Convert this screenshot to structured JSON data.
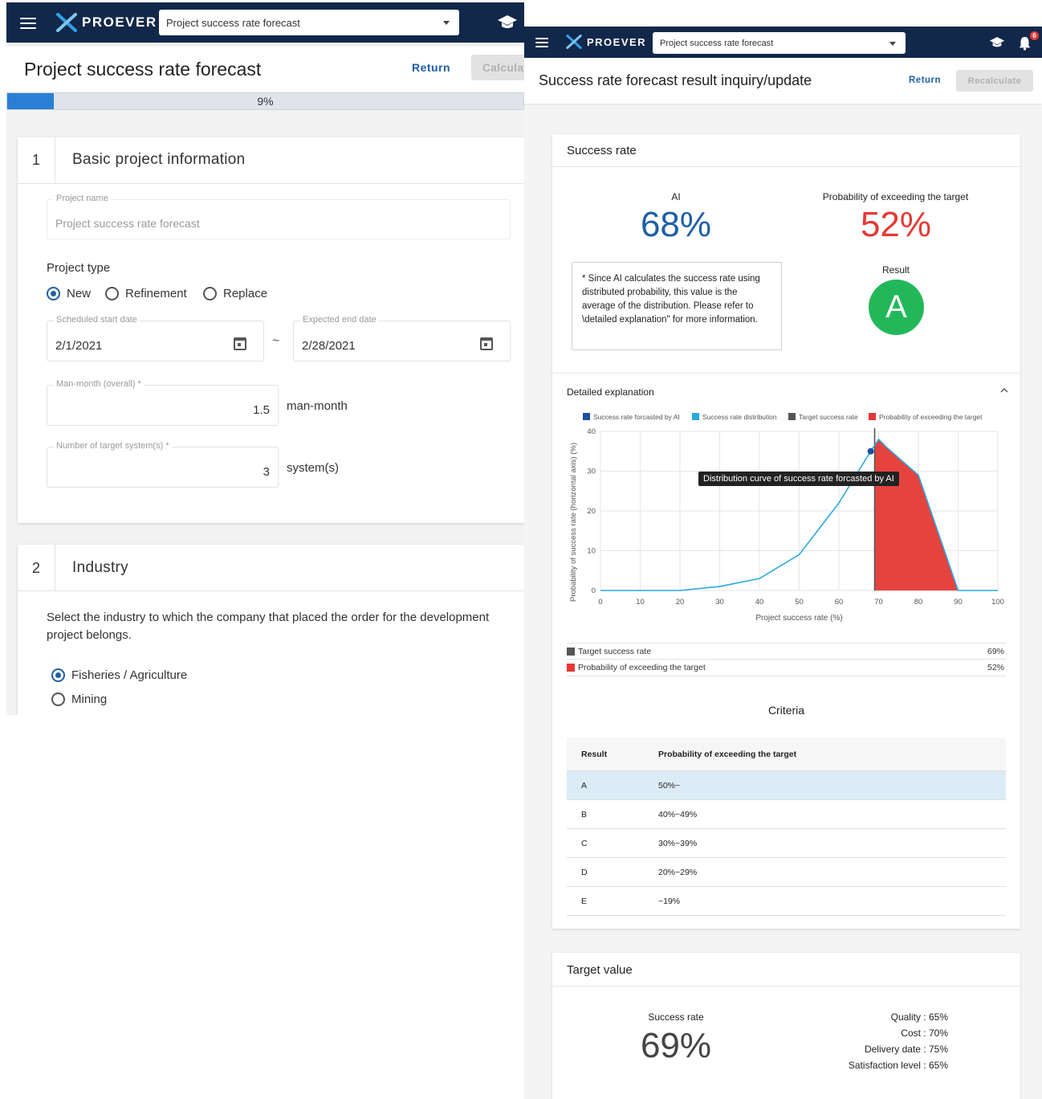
{
  "left": {
    "brand": "PROEVER",
    "project_select": "Project success rate forecast",
    "notification_count": "6",
    "page_title": "Project success rate forecast",
    "return_label": "Return",
    "calc_label": "Calculate",
    "progress": {
      "percent_label": "9%",
      "fraction": 0.09
    },
    "section1": {
      "number": "1",
      "title": "Basic project information",
      "project_name_label": "Project name",
      "project_name_value": "Project success rate forecast",
      "project_type_label": "Project type",
      "project_type_options": [
        "New",
        "Refinement",
        "Replace"
      ],
      "project_type_selected": "New",
      "start_label": "Scheduled start date",
      "start_value": "2/1/2021",
      "tilde": "~",
      "end_label": "Expected end date",
      "end_value": "2/28/2021",
      "man_month_label": "Man-month (overall)",
      "man_month_value": "1.5",
      "man_month_unit": "man-month",
      "systems_label": "Number of target system(s)",
      "systems_value": "3",
      "systems_unit": "system(s)",
      "required_mark": "*"
    },
    "section2": {
      "number": "2",
      "title": "Industry",
      "description": "Select the industry to which the company that placed the order for the development project belongs.",
      "options": [
        "Fisheries / Agriculture",
        "Mining"
      ],
      "selected": "Fisheries / Agriculture"
    }
  },
  "right": {
    "brand": "PROEVER",
    "project_select": "Project success rate forecast",
    "notification_count": "6",
    "page_title": "Success rate forecast result inquiry/update",
    "return_label": "Return",
    "recalc_label": "Recalculate",
    "success_card": {
      "title": "Success rate",
      "ai_label": "AI",
      "ai_value": "68%",
      "prob_label": "Probability of exceeding the target",
      "prob_value": "52%",
      "note": "* Since AI calculates the success rate using distributed probability, this value is the average of the distribution. Please refer to \\detailed explanation\" for more information.",
      "result_label": "Result",
      "result_grade": "A",
      "accent_blue": "#1e5fa8",
      "accent_red": "#e53935",
      "grade_green": "#22b85a"
    },
    "detail": {
      "title": "Detailed explanation",
      "tooltip": "Distribution curve of success rate forcasted by AI",
      "summary": [
        {
          "label": "Target success rate",
          "value": "69%",
          "color": "#555555"
        },
        {
          "label": "Probability of exceeding the target",
          "value": "52%",
          "color": "#e53935"
        }
      ]
    },
    "criteria": {
      "title": "Criteria",
      "headers": [
        "Result",
        "Probability of exceeding the target"
      ],
      "rows": [
        [
          "A",
          "50%~"
        ],
        [
          "B",
          "40%~49%"
        ],
        [
          "C",
          "30%~39%"
        ],
        [
          "D",
          "20%~29%"
        ],
        [
          "E",
          "~19%"
        ]
      ]
    },
    "target_card": {
      "title": "Target value",
      "success_label": "Success rate",
      "success_value": "69%",
      "breakdown": [
        "Quality : 65%",
        "Cost : 70%",
        "Delivery date : 75%",
        "Satisfaction level : 65%"
      ]
    }
  },
  "chart_data": {
    "type": "area",
    "title": "",
    "xlabel": "Project success rate (%)",
    "ylabel": "Probability of success rate (horizontal axis) (%)",
    "xlim": [
      0,
      100
    ],
    "ylim": [
      0,
      40
    ],
    "x_ticks": [
      0,
      10,
      20,
      30,
      40,
      50,
      60,
      70,
      80,
      90,
      100
    ],
    "y_ticks": [
      0,
      10,
      20,
      30,
      40
    ],
    "legend": [
      "Success rate forcasted by AI",
      "Success rate distribution",
      "Target success rate",
      "Probability of exceeding the target"
    ],
    "legend_colors": [
      "#1e4f9c",
      "#29a8e0",
      "#555555",
      "#e53935"
    ],
    "grid": true,
    "distribution": {
      "name": "Success rate distribution",
      "x": [
        0,
        20,
        30,
        40,
        50,
        60,
        68,
        70,
        72,
        80,
        90,
        100
      ],
      "y": [
        0,
        0,
        1,
        3,
        9,
        22,
        35,
        38,
        36,
        29,
        0,
        0
      ]
    },
    "ai_point": {
      "x": 68,
      "y": 35
    },
    "target_x": 69
  }
}
